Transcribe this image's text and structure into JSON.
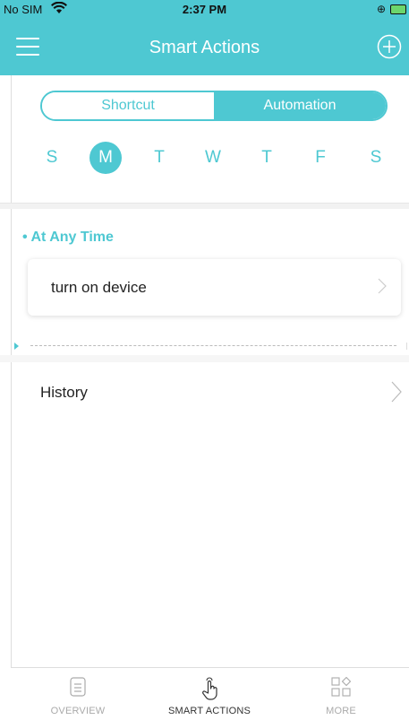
{
  "status_bar": {
    "carrier": "No SIM",
    "time": "2:37 PM",
    "icons": [
      "wifi-icon",
      "lock-rotation-icon",
      "battery-charging-icon"
    ]
  },
  "nav": {
    "title": "Smart Actions",
    "left_icon": "hamburger-menu-icon",
    "right_icon": "add-circle-icon"
  },
  "segments": {
    "shortcut": "Shortcut",
    "automation": "Automation",
    "selected": "Automation"
  },
  "days": {
    "items": [
      "S",
      "M",
      "T",
      "W",
      "T",
      "F",
      "S"
    ],
    "selected_index": 1
  },
  "section": {
    "title": "• At Any Time"
  },
  "actions": [
    {
      "label": "turn on device"
    }
  ],
  "history": {
    "label": "History"
  },
  "tabs": [
    {
      "label": "OVERVIEW",
      "icon": "document-list-icon"
    },
    {
      "label": "SMART ACTIONS",
      "icon": "hand-tap-icon",
      "active": true
    },
    {
      "label": "MORE",
      "icon": "grid-shapes-icon"
    }
  ],
  "colors": {
    "accent": "#4ec8d2",
    "text": "#222222",
    "muted": "#aaaaaa"
  }
}
